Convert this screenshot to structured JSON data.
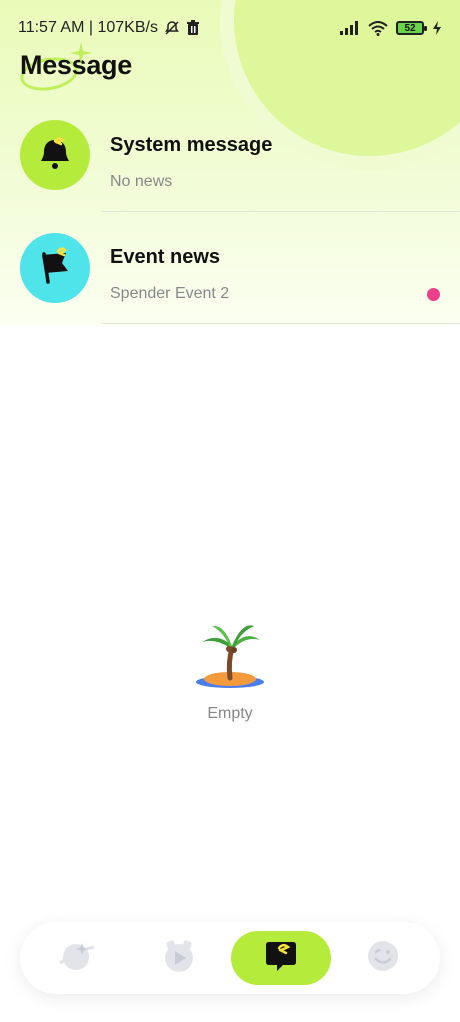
{
  "status_bar": {
    "time_speed": "11:57 AM | 107KB/s",
    "battery": "52",
    "icons": [
      "mute-bell-icon",
      "trash-icon",
      "signal-icon",
      "wifi-icon",
      "battery-icon",
      "charging-icon"
    ]
  },
  "header": {
    "title": "Message"
  },
  "messages": [
    {
      "title": "System message",
      "subtitle": "No news",
      "icon": "bell-icon",
      "avatar_color": "#b5ec3c",
      "unread": false
    },
    {
      "title": "Event news",
      "subtitle": "Spender Event 2",
      "icon": "flag-icon",
      "avatar_color": "#4fe3ea",
      "unread": true
    }
  ],
  "empty_state": {
    "icon": "palm-island-icon",
    "text": "Empty"
  },
  "bottom_nav": {
    "items": [
      {
        "icon": "planet-icon",
        "active": false
      },
      {
        "icon": "video-play-icon",
        "active": false
      },
      {
        "icon": "message-icon",
        "active": true
      },
      {
        "icon": "smile-icon",
        "active": false
      }
    ],
    "accent": "#b5ec3c"
  },
  "colors": {
    "accent_green": "#b5ec3c",
    "accent_cyan": "#4fe3ea",
    "unread_dot": "#ee3f8a"
  }
}
